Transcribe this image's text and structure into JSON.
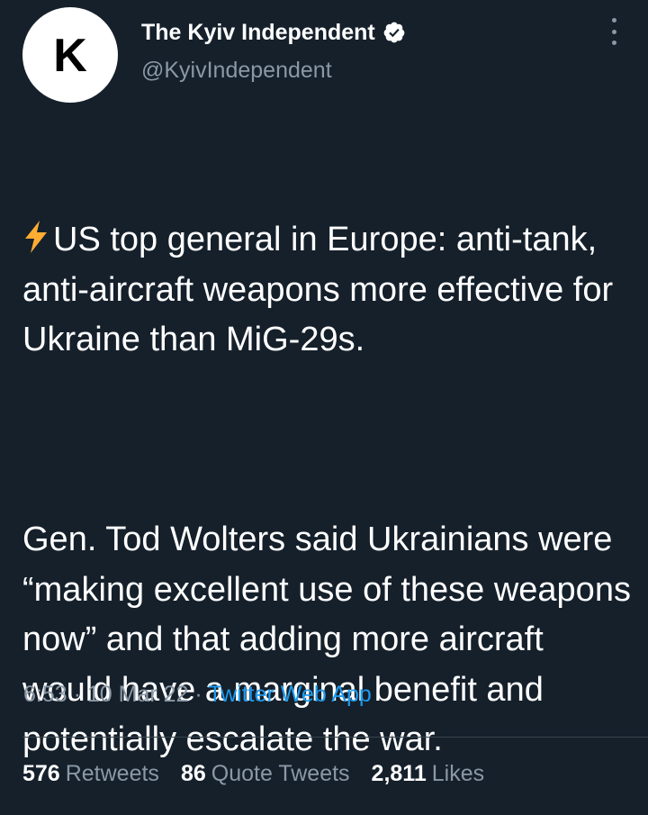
{
  "author": {
    "avatar_letter": "K",
    "display_name": "The Kyiv Independent",
    "handle": "@KyivIndependent",
    "verified": true
  },
  "tweet": {
    "emoji_icon": "high-voltage-icon",
    "paragraph_1": "US top general in Europe: anti-tank, anti-aircraft weapons more effective for Ukraine than MiG-29s.",
    "paragraph_2": "Gen. Tod Wolters said Ukrainians were “making excellent use of these weapons now” and that adding more aircraft would have a marginal benefit and potentially escalate the war."
  },
  "meta": {
    "time": "6:53",
    "separator": " · ",
    "date": "10 Mar 22",
    "source": "Twitter Web App"
  },
  "stats": {
    "retweets_count": "576",
    "retweets_label": "Retweets",
    "quotes_count": "86",
    "quotes_label": "Quote Tweets",
    "likes_count": "2,811",
    "likes_label": "Likes"
  },
  "colors": {
    "background": "#15202b",
    "text_primary": "#ffffff",
    "text_secondary": "#8b98a5",
    "link": "#1d9bf0",
    "divider": "#38444d",
    "bolt": "#ffac33"
  }
}
